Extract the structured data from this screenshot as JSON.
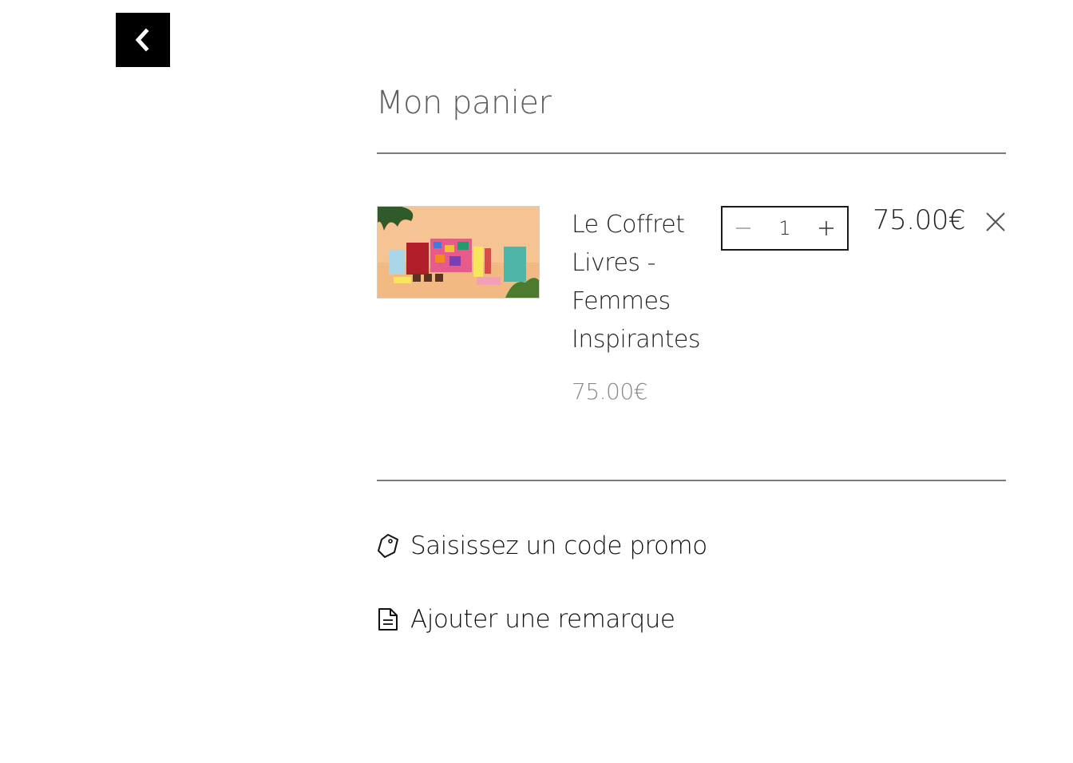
{
  "header": {
    "back_icon": "chevron-left-icon",
    "title": "Mon panier"
  },
  "cart": {
    "items": [
      {
        "name": "Le Coffret Livres - Femmes Inspirantes",
        "unit_price": "75.00€",
        "quantity": "1",
        "line_total": "75.00€",
        "image": "product-thumbnail"
      }
    ]
  },
  "actions": {
    "promo_label": "Saisissez un code promo",
    "promo_icon": "tag-icon",
    "note_label": "Ajouter une remarque",
    "note_icon": "document-icon"
  },
  "colors": {
    "back_button_bg": "#000000",
    "divider": "#7a7a7a",
    "muted_text": "#8a8a8a"
  }
}
